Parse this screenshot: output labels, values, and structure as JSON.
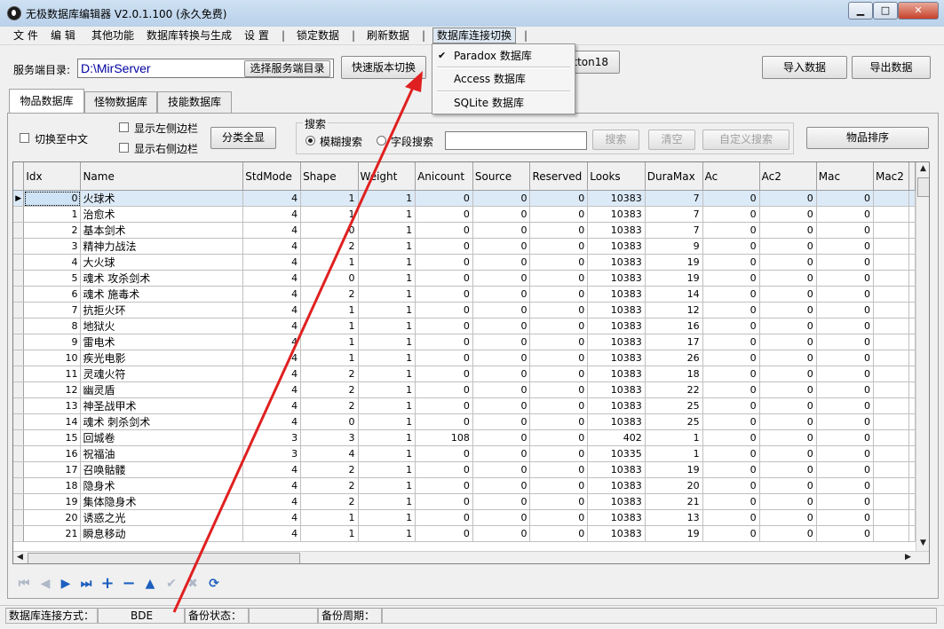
{
  "window": {
    "title": "无极数据库编辑器 V2.0.1.100 (永久免费)",
    "minimize_glyph": "▁",
    "maximize_glyph": "□",
    "close_glyph": "✕"
  },
  "menu": {
    "items": [
      "文 件",
      "编 辑",
      "其他功能",
      "数据库转换与生成",
      "设 置"
    ],
    "separator": "|",
    "lock": "锁定数据",
    "refresh": "刷新数据",
    "switch": "数据库连接切换"
  },
  "dropdown": {
    "items": [
      {
        "label": "Paradox     数据库",
        "checked": true
      },
      {
        "label": "Access 数据库",
        "checked": false
      },
      {
        "label": "SQLite  数据库",
        "checked": false
      }
    ],
    "check_glyph": "✔"
  },
  "toolbar": {
    "server_dir_label": "服务端目录:",
    "server_dir_value": "D:\\MirServer",
    "select_server_button": "选择服务端目录",
    "quick_version_button": "快速版本切换",
    "button18": "Button18",
    "import_button": "导入数据",
    "export_button": "导出数据"
  },
  "tabs": [
    "物品数据库",
    "怪物数据库",
    "技能数据库"
  ],
  "options": {
    "switch_chinese": "切换至中文",
    "show_left": "显示左侧边栏",
    "show_right": "显示右侧边栏",
    "show_all_button": "分类全显"
  },
  "search": {
    "legend": "搜索",
    "fuzzy": "模糊搜索",
    "field": "字段搜索",
    "search_button": "搜索",
    "clear_button": "清空",
    "custom_button": "自定义搜索",
    "sort_button": "物品排序"
  },
  "grid": {
    "columns": [
      "Idx",
      "Name",
      "StdMode",
      "Shape",
      "Weight",
      "Anicount",
      "Source",
      "Reserved",
      "Looks",
      "DuraMax",
      "Ac",
      "Ac2",
      "Mac",
      "Mac2"
    ],
    "rows": [
      [
        "0",
        "火球术",
        "4",
        "1",
        "1",
        "0",
        "0",
        "0",
        "10383",
        "7",
        "0",
        "0",
        "0",
        ""
      ],
      [
        "1",
        "治愈术",
        "4",
        "1",
        "1",
        "0",
        "0",
        "0",
        "10383",
        "7",
        "0",
        "0",
        "0",
        ""
      ],
      [
        "2",
        "基本剑术",
        "4",
        "0",
        "1",
        "0",
        "0",
        "0",
        "10383",
        "7",
        "0",
        "0",
        "0",
        ""
      ],
      [
        "3",
        "精神力战法",
        "4",
        "2",
        "1",
        "0",
        "0",
        "0",
        "10383",
        "9",
        "0",
        "0",
        "0",
        ""
      ],
      [
        "4",
        "大火球",
        "4",
        "1",
        "1",
        "0",
        "0",
        "0",
        "10383",
        "19",
        "0",
        "0",
        "0",
        ""
      ],
      [
        "5",
        "魂术 攻杀剑术",
        "4",
        "0",
        "1",
        "0",
        "0",
        "0",
        "10383",
        "19",
        "0",
        "0",
        "0",
        ""
      ],
      [
        "6",
        "魂术 施毒术",
        "4",
        "2",
        "1",
        "0",
        "0",
        "0",
        "10383",
        "14",
        "0",
        "0",
        "0",
        ""
      ],
      [
        "7",
        "抗拒火环",
        "4",
        "1",
        "1",
        "0",
        "0",
        "0",
        "10383",
        "12",
        "0",
        "0",
        "0",
        ""
      ],
      [
        "8",
        "地狱火",
        "4",
        "1",
        "1",
        "0",
        "0",
        "0",
        "10383",
        "16",
        "0",
        "0",
        "0",
        ""
      ],
      [
        "9",
        "雷电术",
        "4",
        "1",
        "1",
        "0",
        "0",
        "0",
        "10383",
        "17",
        "0",
        "0",
        "0",
        ""
      ],
      [
        "10",
        "疾光电影",
        "4",
        "1",
        "1",
        "0",
        "0",
        "0",
        "10383",
        "26",
        "0",
        "0",
        "0",
        ""
      ],
      [
        "11",
        "灵魂火符",
        "4",
        "2",
        "1",
        "0",
        "0",
        "0",
        "10383",
        "18",
        "0",
        "0",
        "0",
        ""
      ],
      [
        "12",
        "幽灵盾",
        "4",
        "2",
        "1",
        "0",
        "0",
        "0",
        "10383",
        "22",
        "0",
        "0",
        "0",
        ""
      ],
      [
        "13",
        "神圣战甲术",
        "4",
        "2",
        "1",
        "0",
        "0",
        "0",
        "10383",
        "25",
        "0",
        "0",
        "0",
        ""
      ],
      [
        "14",
        "魂术 刺杀剑术",
        "4",
        "0",
        "1",
        "0",
        "0",
        "0",
        "10383",
        "25",
        "0",
        "0",
        "0",
        ""
      ],
      [
        "15",
        "回城卷",
        "3",
        "3",
        "1",
        "108",
        "0",
        "0",
        "402",
        "1",
        "0",
        "0",
        "0",
        ""
      ],
      [
        "16",
        "祝福油",
        "3",
        "4",
        "1",
        "0",
        "0",
        "0",
        "10335",
        "1",
        "0",
        "0",
        "0",
        ""
      ],
      [
        "17",
        "召唤骷髅",
        "4",
        "2",
        "1",
        "0",
        "0",
        "0",
        "10383",
        "19",
        "0",
        "0",
        "0",
        ""
      ],
      [
        "18",
        "隐身术",
        "4",
        "2",
        "1",
        "0",
        "0",
        "0",
        "10383",
        "20",
        "0",
        "0",
        "0",
        ""
      ],
      [
        "19",
        "集体隐身术",
        "4",
        "2",
        "1",
        "0",
        "0",
        "0",
        "10383",
        "21",
        "0",
        "0",
        "0",
        ""
      ],
      [
        "20",
        "诱惑之光",
        "4",
        "1",
        "1",
        "0",
        "0",
        "0",
        "10383",
        "13",
        "0",
        "0",
        "0",
        ""
      ],
      [
        "21",
        "瞬息移动",
        "4",
        "1",
        "1",
        "0",
        "0",
        "0",
        "10383",
        "19",
        "0",
        "0",
        "0",
        ""
      ]
    ],
    "selected_row": 0,
    "row_indicator": "▶"
  },
  "navigator": {
    "first": "⏮",
    "prior": "◀",
    "next": "▶",
    "last": "⏭",
    "insert": "+",
    "delete": "−",
    "edit": "▲",
    "post": "✔",
    "cancel": "✖",
    "refresh": "⟳"
  },
  "status": {
    "conn_label": "数据库连接方式：",
    "conn_value": "BDE",
    "backup_state_label": "备份状态：",
    "backup_state_value": "",
    "backup_period_label": "备份周期：",
    "backup_period_value": ""
  },
  "colors": {
    "accent_blue": "#0000a0",
    "arrow_red": "#e02020",
    "selection": "#dceaf7"
  }
}
